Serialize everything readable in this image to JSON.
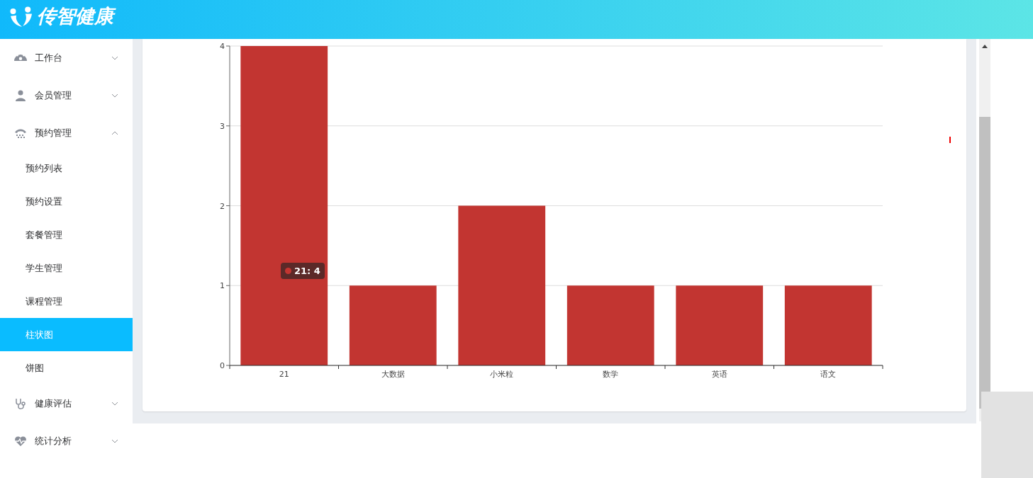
{
  "header": {
    "logo_text": "传智健康"
  },
  "sidebar": {
    "items": [
      {
        "label": "工作台",
        "expanded": false
      },
      {
        "label": "会员管理",
        "expanded": false
      },
      {
        "label": "预约管理",
        "expanded": true,
        "children": [
          {
            "label": "预约列表",
            "selected": false
          },
          {
            "label": "预约设置",
            "selected": false
          },
          {
            "label": "套餐管理",
            "selected": false
          },
          {
            "label": "学生管理",
            "selected": false
          },
          {
            "label": "课程管理",
            "selected": false
          },
          {
            "label": "柱状图",
            "selected": true
          },
          {
            "label": "饼图",
            "selected": false
          }
        ]
      },
      {
        "label": "健康评估",
        "expanded": false
      },
      {
        "label": "统计分析",
        "expanded": false
      }
    ]
  },
  "main": {
    "tooltip": {
      "text": "21: 4",
      "color": "#c23531"
    },
    "chart_data": {
      "type": "bar",
      "grid": true,
      "categories": [
        "21",
        "大数据",
        "小米粒",
        "数学",
        "英语",
        "语文"
      ],
      "series": [
        {
          "color": "#c23531",
          "values": [
            4,
            1,
            2,
            1,
            1,
            1
          ]
        }
      ],
      "ylim": [
        0,
        4
      ],
      "yticks": [
        0,
        1,
        2,
        3,
        4
      ]
    }
  }
}
